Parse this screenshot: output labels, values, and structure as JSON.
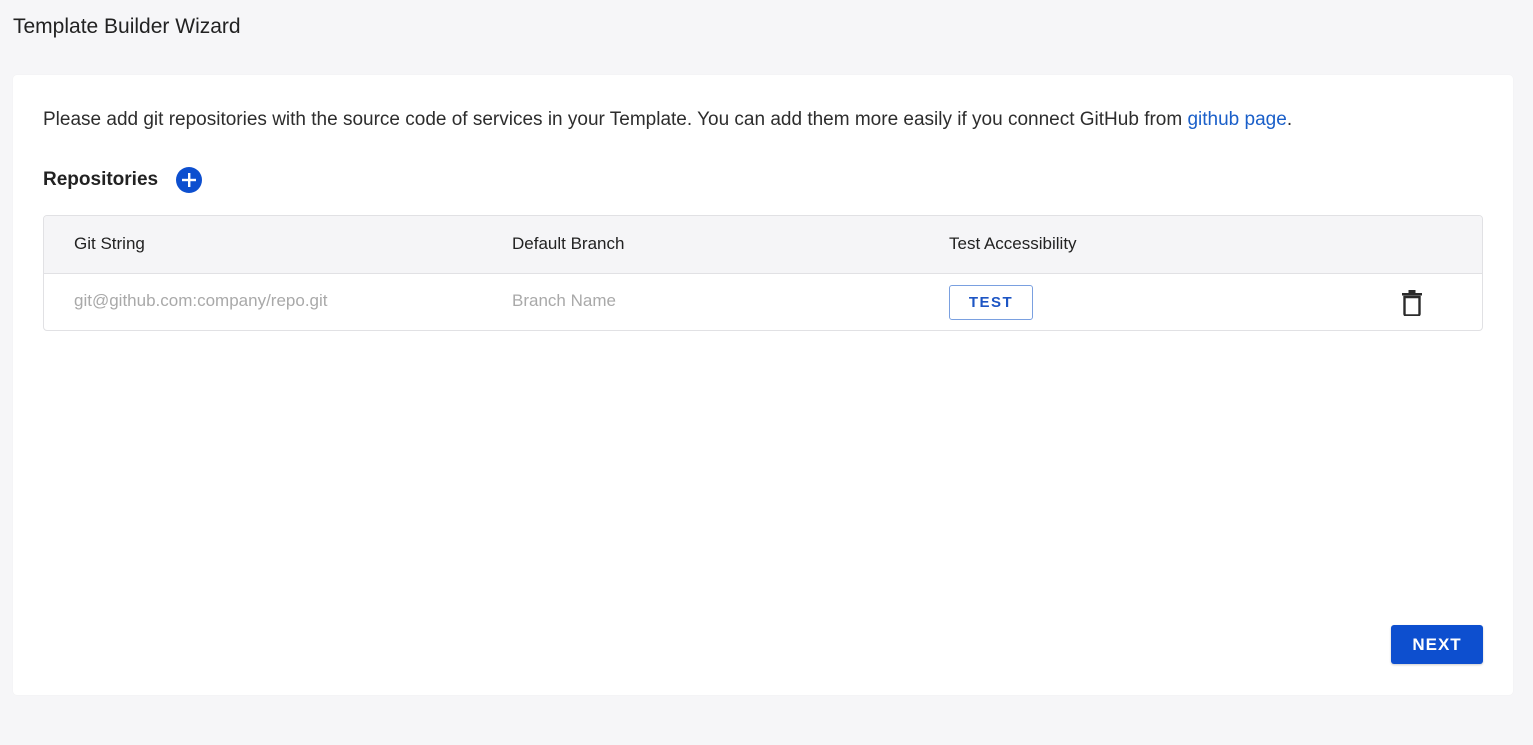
{
  "header": {
    "title": "Template Builder Wizard"
  },
  "intro": {
    "text": "Please add git repositories with the source code of services in your Template. You can add them more easily if you connect GitHub from ",
    "link_label": "github page",
    "suffix": "."
  },
  "repositories": {
    "label": "Repositories",
    "add_icon": "plus-circle-icon",
    "columns": [
      "Git String",
      "Default Branch",
      "Test Accessibility"
    ],
    "rows": [
      {
        "git_string": {
          "value": "",
          "placeholder": "git@github.com:company/repo.git"
        },
        "branch": {
          "value": "",
          "placeholder": "Branch Name"
        },
        "test_label": "TEST",
        "delete_icon": "trash-icon"
      }
    ]
  },
  "footer": {
    "next_label": "NEXT"
  },
  "colors": {
    "primary": "#0d4fcf",
    "link": "#1a5fc9",
    "background": "#f6f6f8"
  }
}
